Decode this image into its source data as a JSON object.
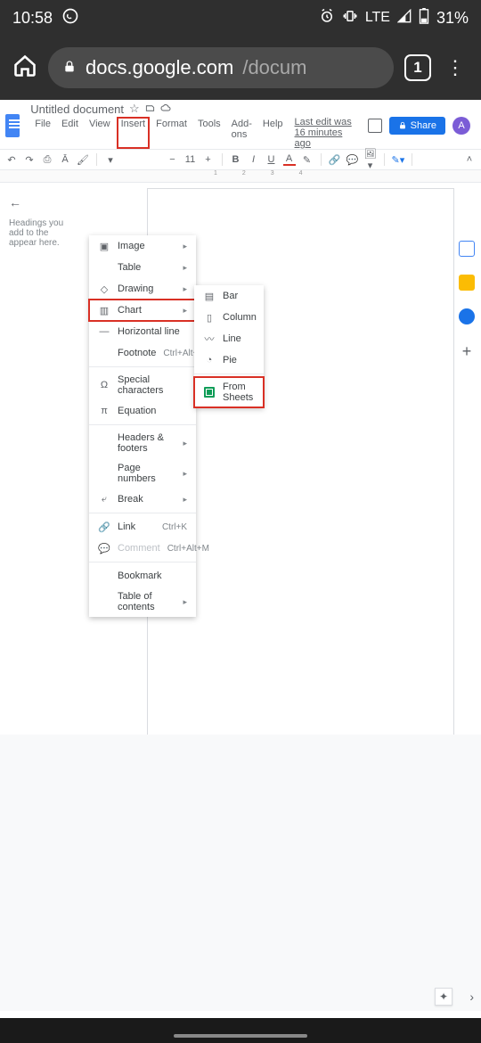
{
  "status": {
    "time": "10:58",
    "battery": "31%",
    "lte": "LTE"
  },
  "chrome": {
    "url_host": "docs.google.com",
    "url_path": "/docum",
    "tab_count": "1"
  },
  "docs": {
    "title": "Untitled document",
    "last_edit": "Last edit was 16 minutes ago",
    "share": "Share",
    "avatar": "A",
    "menus": [
      "File",
      "Edit",
      "View",
      "Insert",
      "Format",
      "Tools",
      "Add-ons",
      "Help"
    ]
  },
  "toolbar": {
    "font_size": "11"
  },
  "outline": {
    "hint": "Headings you add to the",
    "hint2": "appear here."
  },
  "insert_menu": {
    "image": "Image",
    "table": "Table",
    "drawing": "Drawing",
    "chart": "Chart",
    "hline": "Horizontal line",
    "footnote": "Footnote",
    "footnote_sc": "Ctrl+Alt+F",
    "special": "Special characters",
    "equation": "Equation",
    "headers": "Headers & footers",
    "pagenums": "Page numbers",
    "break": "Break",
    "link": "Link",
    "link_sc": "Ctrl+K",
    "comment": "Comment",
    "comment_sc": "Ctrl+Alt+M",
    "bookmark": "Bookmark",
    "toc": "Table of contents"
  },
  "chart_menu": {
    "bar": "Bar",
    "column": "Column",
    "line": "Line",
    "pie": "Pie",
    "sheets": "From Sheets"
  },
  "ruler": "1234"
}
